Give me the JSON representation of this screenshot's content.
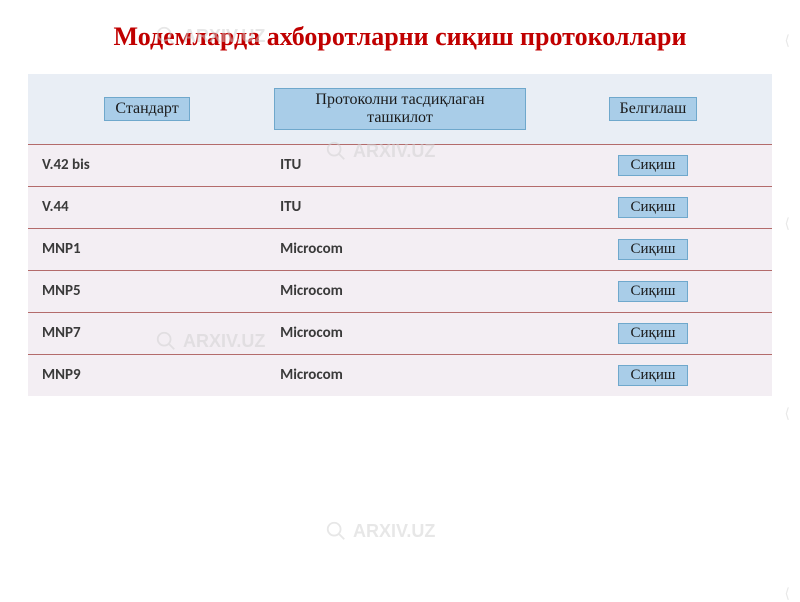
{
  "title": "Модемларда ахборотларни сиқиш протоколлари",
  "watermark": "ARXIV.UZ",
  "table": {
    "headers": {
      "col1": "Стандарт",
      "col2": "Протоколни тасдиқлаган ташкилот",
      "col3": "Белгилаш"
    },
    "rows": [
      {
        "standard": "V.42 bis",
        "org": "ITU",
        "label": "Сиқиш"
      },
      {
        "standard": "V.44",
        "org": "ITU",
        "label": "Сиқиш"
      },
      {
        "standard": "MNP1",
        "org": "Microcom",
        "label": "Сиқиш"
      },
      {
        "standard": "MNP5",
        "org": "Microcom",
        "label": "Сиқиш"
      },
      {
        "standard": "MNP7",
        "org": "Microcom",
        "label": "Сиқиш"
      },
      {
        "standard": "MNP9",
        "org": "Microcom",
        "label": "Сиқиш"
      }
    ]
  }
}
